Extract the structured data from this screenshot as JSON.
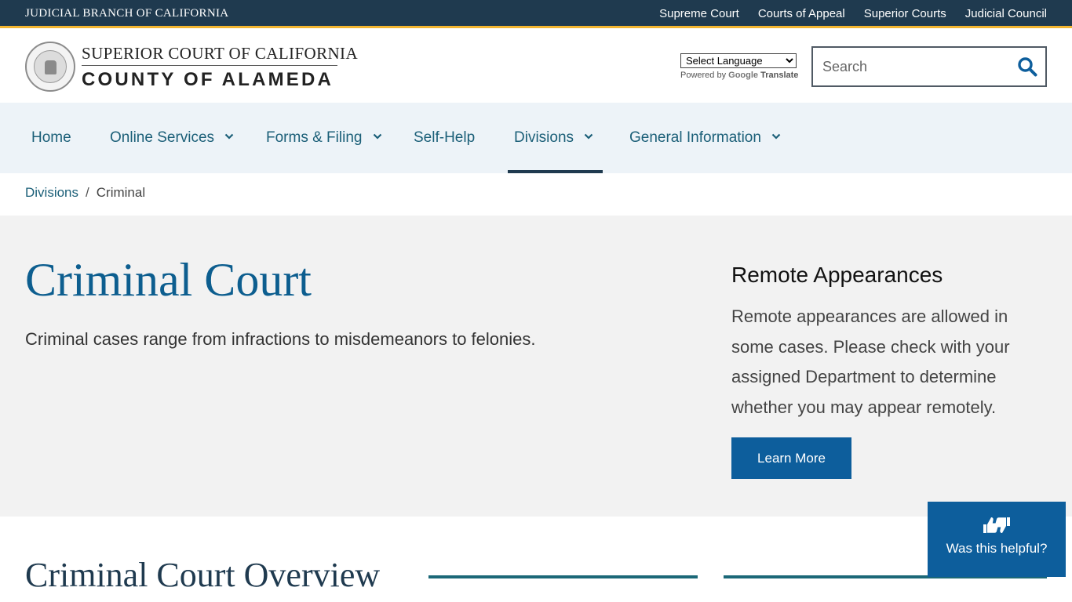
{
  "topbar": {
    "branch_title": "JUDICIAL BRANCH OF CALIFORNIA",
    "links": [
      "Supreme Court",
      "Courts of Appeal",
      "Superior Courts",
      "Judicial Council"
    ]
  },
  "header": {
    "court_line1": "SUPERIOR COURT OF CALIFORNIA",
    "court_line2": "COUNTY OF ALAMEDA",
    "language_select": "Select Language",
    "powered_by": "Powered by",
    "google": "Google",
    "translate": "Translate",
    "search_placeholder": "Search"
  },
  "nav": {
    "items": [
      {
        "label": "Home"
      },
      {
        "label": "Online Services"
      },
      {
        "label": "Forms & Filing"
      },
      {
        "label": "Self-Help"
      },
      {
        "label": "Divisions"
      },
      {
        "label": "General Information"
      }
    ],
    "active": "Divisions"
  },
  "breadcrumb": {
    "parent": "Divisions",
    "separator": "/",
    "current": "Criminal"
  },
  "hero": {
    "title": "Criminal Court",
    "lead": "Criminal cases range from infractions to misdemeanors to felonies."
  },
  "remote": {
    "title": "Remote Appearances",
    "body": "Remote appearances are allowed in some cases. Please check with your assigned Department to determine whether you may appear remotely.",
    "button": "Learn More"
  },
  "overview": {
    "title": "Criminal Court Overview"
  },
  "feedback": {
    "label": "Was this helpful?"
  },
  "colors": {
    "topbar": "#1f3a4f",
    "accent_gold": "#f2b530",
    "nav_bg": "#edf3f8",
    "link": "#1b5f78",
    "heading_blue": "#0d5e8f",
    "button_blue": "#0d5e9c",
    "hero_bg": "#f2f2f2"
  }
}
